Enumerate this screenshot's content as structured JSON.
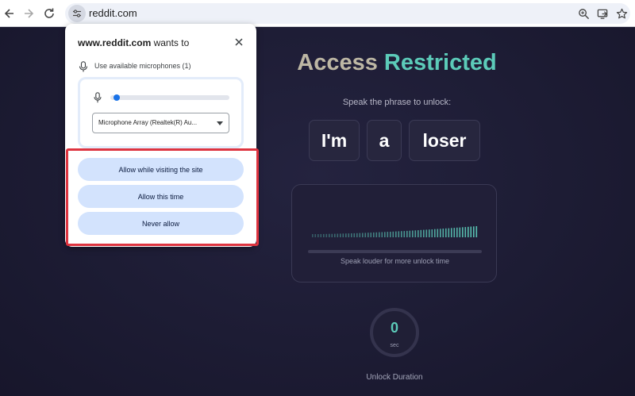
{
  "browser": {
    "url": "reddit.com",
    "icons": {
      "back": "arrow-left-icon",
      "forward": "arrow-right-icon",
      "reload": "reload-icon",
      "site_info": "tune-icon",
      "zoom": "zoom-icon",
      "install": "install-app-icon",
      "bookmark": "star-icon"
    }
  },
  "permission_popup": {
    "site": "www.reddit.com",
    "wants_to": " wants to",
    "permission_label": "Use available microphones (1)",
    "mic_level": 0.03,
    "mic_device": "Microphone Array (Realtek(R) Au...",
    "buttons": {
      "allow_visiting": "Allow while visiting the site",
      "allow_once": "Allow this time",
      "never": "Never allow"
    },
    "highlight_color": "#de3440"
  },
  "page": {
    "title_part1": "Access",
    "title_part2": " Restricted",
    "subtitle": "Speak the phrase to unlock:",
    "phrase_words": [
      "I'm",
      "a",
      "loser"
    ],
    "meter_hint": "Speak louder for more unlock time",
    "timer_value": "0",
    "timer_unit": "sec",
    "unlock_label": "Unlock Duration",
    "colors": {
      "accent": "#5ccbb9",
      "title_gray": "#bdb7a4",
      "background": "#1c1b33"
    }
  }
}
